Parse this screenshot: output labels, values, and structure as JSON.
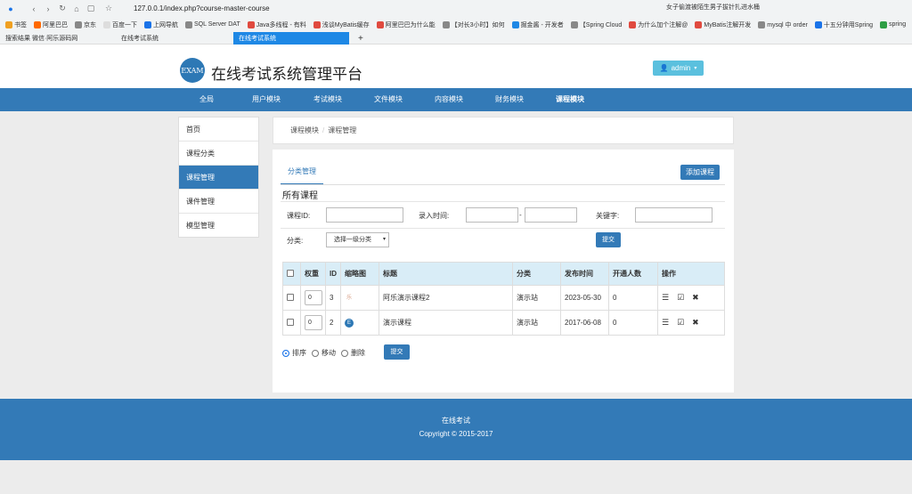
{
  "browser": {
    "url": "127.0.0.1/index.php?course-master-course",
    "search": "女子偷渡被陌生男子拔针扎进水桶",
    "bookmarks": [
      "书签",
      "阿里巴巴",
      "京东",
      "百度一下",
      "上网导航",
      "SQL Server DAT",
      "Java多线程 - 有料",
      "浅谈MyBatis缓存",
      "阿里巴巴为什么能",
      "【对长3小时】如何",
      "掘金酱 - 开发者",
      "【Spring Cloud",
      "为什么加个注解@",
      "MyBatis注解开发",
      "mysql 中 order",
      "十五分钟用Spring",
      "spring"
    ],
    "tabs": [
      "搜索结果 微信·阿乐源码网",
      "在线考试系统",
      "在线考试系统"
    ],
    "new_tab": "+"
  },
  "header": {
    "logo": "EXAM",
    "site_name": "在线考试系统管理平台",
    "user_button": "admin"
  },
  "nav": {
    "items": [
      "全局",
      "用户模块",
      "考试模块",
      "文件模块",
      "内容模块",
      "财务模块",
      "课程模块"
    ]
  },
  "sidebar": {
    "items": [
      "首页",
      "课程分类",
      "课程管理",
      "课件管理",
      "模型管理"
    ]
  },
  "breadcrumb": {
    "parent": "课程模块",
    "sep": "/",
    "current": "课程管理"
  },
  "panel": {
    "tab": "分类管理",
    "add_button": "添加课程",
    "title": "所有课程",
    "filters": {
      "course_id_label": "课程ID:",
      "time_label": "录入时间:",
      "time_sep": "-",
      "keyword_label": "关键字:",
      "category_label": "分类:",
      "category_value": "选择一级分类",
      "submit": "提交"
    },
    "table": {
      "headers": [
        "",
        "权重",
        "ID",
        "缩略图",
        "标题",
        "分类",
        "发布时间",
        "开通人数",
        "操作"
      ],
      "rows": [
        {
          "weight": "0",
          "id": "3",
          "thumb": "乐",
          "title": "阿乐演示课程2",
          "category": "演示站",
          "date": "2023-05-30",
          "count": "0"
        },
        {
          "weight": "0",
          "id": "2",
          "thumb": "E",
          "title": "演示课程",
          "category": "演示站",
          "date": "2017-06-08",
          "count": "0"
        }
      ]
    },
    "actions": {
      "sort": "排序",
      "move": "移动",
      "delete": "删除",
      "submit": "提交"
    }
  },
  "footer": {
    "title": "在线考试",
    "copyright": "Copyright © 2015-2017"
  },
  "colors": {
    "primary": "#337ab7",
    "info": "#5bc0de",
    "table_head": "#d9edf7"
  }
}
